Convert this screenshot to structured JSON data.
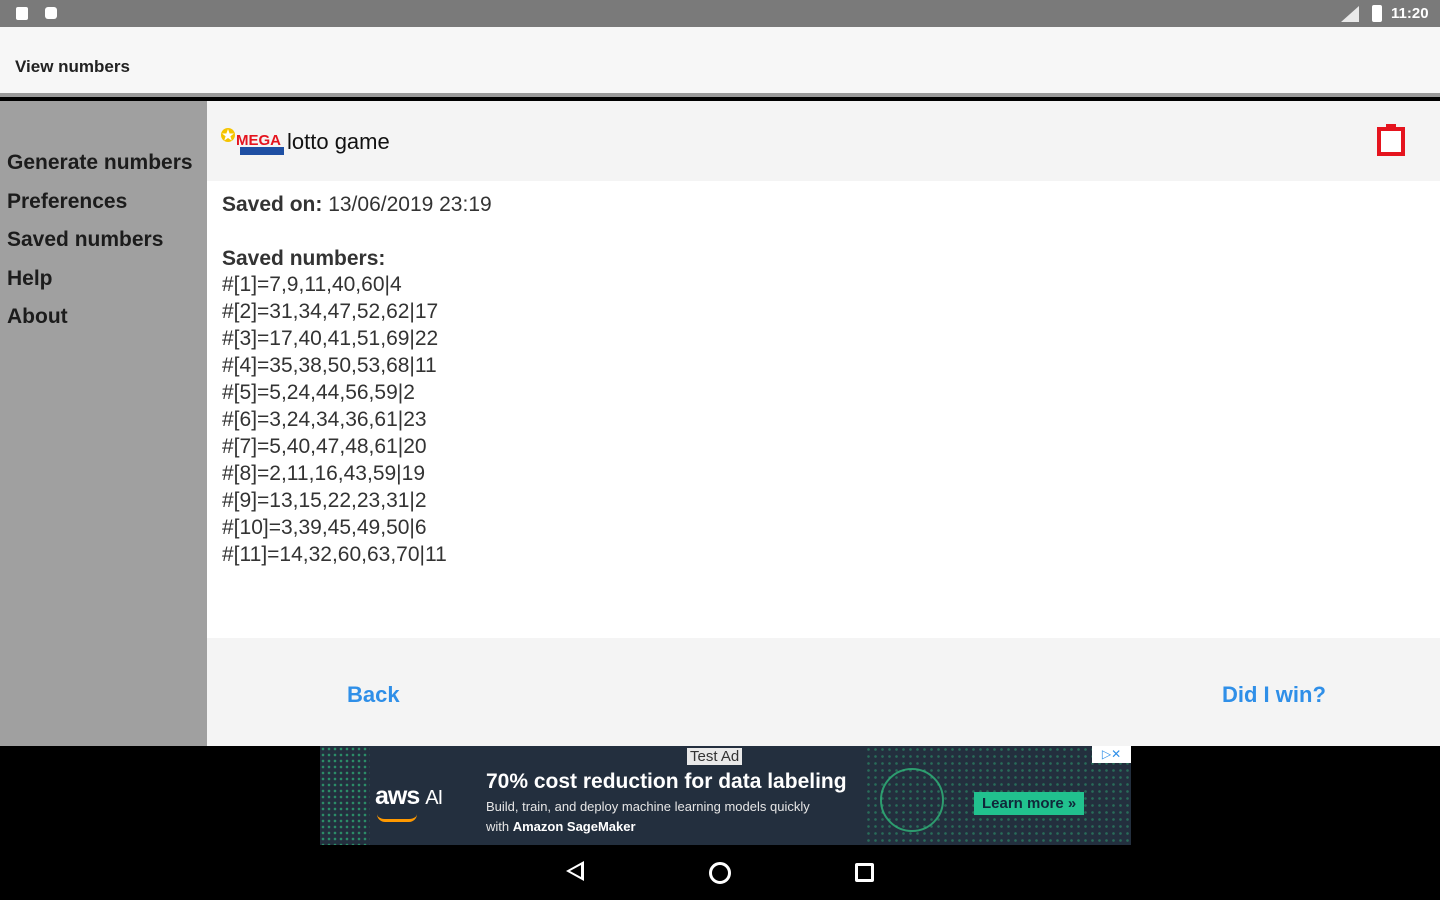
{
  "status_bar": {
    "time": "11:20",
    "icons": [
      "sd-card-icon",
      "notification-icon",
      "signal-icon",
      "battery-icon"
    ]
  },
  "app_bar": {
    "title": "View numbers"
  },
  "sidebar": {
    "items": [
      {
        "label": "Generate numbers"
      },
      {
        "label": "Preferences"
      },
      {
        "label": "Saved numbers"
      },
      {
        "label": "Help"
      },
      {
        "label": "About"
      }
    ]
  },
  "card": {
    "game_name": "lotto game",
    "logo_icon": "mega-millions-logo",
    "delete_icon": "trash-icon",
    "accent_color": "#e5141e",
    "saved_on_label": "Saved on:",
    "saved_on_value": " 13/06/2019 23:19",
    "saved_numbers_label": "Saved numbers:",
    "lines": [
      "#[1]=7,9,11,40,60|4",
      "#[2]=31,34,47,52,62|17",
      "#[3]=17,40,41,51,69|22",
      "#[4]=35,38,50,53,68|11",
      "#[5]=5,24,44,56,59|2",
      "#[6]=3,24,34,36,61|23",
      "#[7]=5,40,47,48,61|20",
      "#[8]=2,11,16,43,59|19",
      "#[9]=13,15,22,23,31|2",
      "#[10]=3,39,45,49,50|6",
      "#[11]=14,32,60,63,70|11"
    ]
  },
  "footer": {
    "back_label": "Back",
    "win_label": "Did I win?",
    "link_color": "#2f8fe8"
  },
  "ad": {
    "badge": "Test Ad",
    "brand": "aws",
    "brand_suffix": "AI",
    "headline": "70% cost reduction for data labeling",
    "body_line1": "Build, train, and deploy machine learning models quickly",
    "body_line2_prefix": "with ",
    "body_line2_bold": "Amazon SageMaker",
    "cta": "Learn more »",
    "adchoices": "▷✕"
  },
  "nav_bar": {
    "icons": [
      "back-icon",
      "home-icon",
      "recents-icon"
    ]
  }
}
